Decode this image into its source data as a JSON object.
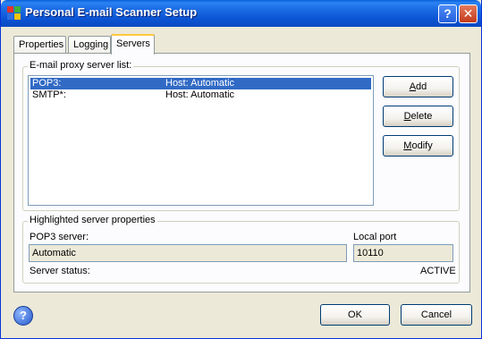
{
  "window": {
    "title": "Personal E-mail Scanner Setup",
    "help_glyph": "?",
    "close_glyph": "✕"
  },
  "tabs": [
    {
      "label": "Properties"
    },
    {
      "label": "Logging"
    },
    {
      "label": "Servers"
    }
  ],
  "server_list": {
    "group_label": "E-mail proxy server list:",
    "rows": [
      {
        "name": "POP3:",
        "host": "Host: Automatic",
        "selected": true
      },
      {
        "name": "SMTP*:",
        "host": "Host: Automatic",
        "selected": false
      }
    ]
  },
  "buttons": {
    "add": {
      "mnemonic": "A",
      "rest": "dd"
    },
    "delete": {
      "mnemonic": "D",
      "rest": "elete"
    },
    "modify": {
      "mnemonic": "M",
      "rest": "odify"
    },
    "ok": "OK",
    "cancel": "Cancel"
  },
  "properties": {
    "group_label": "Highlighted server properties",
    "server_label": "POP3 server:",
    "server_value": "Automatic",
    "port_label": "Local port",
    "port_value": "10110",
    "status_label": "Server status:",
    "status_value": "ACTIVE"
  },
  "help_button_glyph": "?",
  "colors": {
    "titlebar": "#0a5fd8",
    "selection": "#316ac5",
    "close_button": "#c5391b"
  }
}
